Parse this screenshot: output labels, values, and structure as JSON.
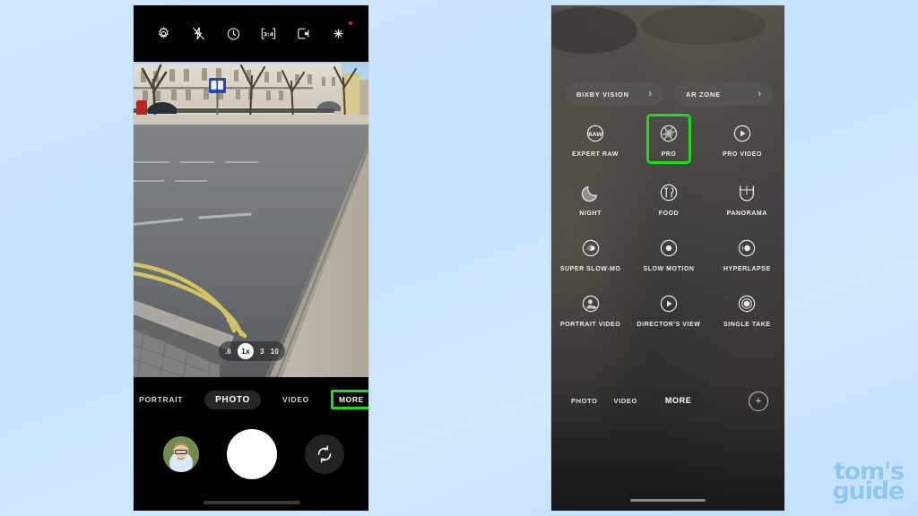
{
  "background": {
    "color_top": "#cfe7fe",
    "color_bottom": "#c3dffc"
  },
  "accent": {
    "highlight_green": "#1ddc1d",
    "brand_blue": "#8cc6f2"
  },
  "left_phone": {
    "label": "samsung-camera-photo-mode",
    "top_bar": {
      "icons": [
        {
          "name": "settings-gear-icon",
          "label": "Settings"
        },
        {
          "name": "flash-off-icon",
          "label": "Flash off"
        },
        {
          "name": "timer-icon",
          "label": "Timer"
        },
        {
          "name": "aspect-ratio-icon",
          "label": "3:4"
        },
        {
          "name": "motion-photo-icon",
          "label": "Motion photo"
        },
        {
          "name": "filters-effects-icon",
          "label": "Filters and effects"
        }
      ]
    },
    "viewfinder": {
      "scene": "Street view of a London terraced row with parked cars, a blue parking sign, bare trees and double yellow lines curving around a kerb.",
      "zoom_levels": [
        {
          "value": ".6",
          "active": false
        },
        {
          "value": "1x",
          "active": true
        },
        {
          "value": "3",
          "active": false
        },
        {
          "value": "10",
          "active": false
        }
      ]
    },
    "mode_strip": [
      {
        "label": "PORTRAIT",
        "selected": false,
        "highlighted": false
      },
      {
        "label": "PHOTO",
        "selected": true,
        "highlighted": false
      },
      {
        "label": "VIDEO",
        "selected": false,
        "highlighted": false
      },
      {
        "label": "MORE",
        "selected": false,
        "highlighted": true
      }
    ],
    "shutter_row": {
      "gallery_thumbnail": "portrait photo of a man with glasses",
      "shutter_button": "Take picture",
      "flip_button": "Switch camera"
    }
  },
  "right_phone": {
    "label": "samsung-camera-more-modes",
    "chips": [
      {
        "label": "BIXBY VISION",
        "chevron": "›"
      },
      {
        "label": "AR ZONE",
        "chevron": "›"
      }
    ],
    "modes": [
      [
        {
          "label": "EXPERT RAW",
          "icon": "raw-icon",
          "selected": false
        },
        {
          "label": "PRO",
          "icon": "aperture-icon",
          "selected": true
        },
        {
          "label": "PRO VIDEO",
          "icon": "play-circle-icon",
          "selected": false
        }
      ],
      [
        {
          "label": "NIGHT",
          "icon": "moon-icon",
          "selected": false
        },
        {
          "label": "FOOD",
          "icon": "cutlery-icon",
          "selected": false
        },
        {
          "label": "PANORAMA",
          "icon": "panorama-icon",
          "selected": false
        }
      ],
      [
        {
          "label": "SUPER SLOW-MO",
          "icon": "super-slow-mo-icon",
          "selected": false
        },
        {
          "label": "SLOW MOTION",
          "icon": "slow-motion-icon",
          "selected": false
        },
        {
          "label": "HYPERLAPSE",
          "icon": "hyperlapse-icon",
          "selected": false
        }
      ],
      [
        {
          "label": "PORTRAIT VIDEO",
          "icon": "portrait-video-icon",
          "selected": false
        },
        {
          "label": "DIRECTOR'S VIEW",
          "icon": "directors-view-icon",
          "selected": false
        },
        {
          "label": "SINGLE TAKE",
          "icon": "single-take-icon",
          "selected": false
        }
      ]
    ],
    "tabs": [
      {
        "label": "PHOTO",
        "selected": false
      },
      {
        "label": "VIDEO",
        "selected": false
      },
      {
        "label": "MORE",
        "selected": true
      }
    ],
    "add_button": "+"
  },
  "watermark": {
    "line1": "tom's",
    "line2": "guide"
  }
}
